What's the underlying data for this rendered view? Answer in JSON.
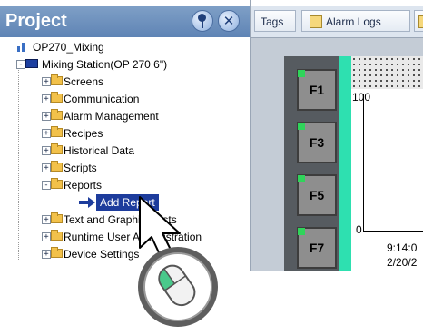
{
  "project_panel": {
    "title": "Project",
    "root": "OP270_Mixing",
    "station": "Mixing Station(OP 270 6\")",
    "items": [
      {
        "label": "Screens",
        "expander": "+"
      },
      {
        "label": "Communication",
        "expander": "+"
      },
      {
        "label": "Alarm Management",
        "expander": "+"
      },
      {
        "label": "Recipes",
        "expander": "+"
      },
      {
        "label": "Historical Data",
        "expander": "+"
      },
      {
        "label": "Scripts",
        "expander": "+"
      },
      {
        "label": "Reports",
        "expander": "-"
      },
      {
        "label": "Add Report"
      },
      {
        "label": "Text and Graphics Lists",
        "expander": "+"
      },
      {
        "label": "Runtime User Administration",
        "expander": "+"
      },
      {
        "label": "Device Settings",
        "expander": "+"
      }
    ]
  },
  "tabs": [
    {
      "label": "Tags"
    },
    {
      "label": "Alarm Logs"
    }
  ],
  "device": {
    "keys": [
      "F1",
      "F3",
      "F5",
      "F7"
    ]
  },
  "trend": {
    "y_max": "100",
    "y_min": "0",
    "time": "9:14:0",
    "date": "2/20/2"
  },
  "colors": {
    "header": "#6f91be",
    "selection": "#1d3c9c",
    "device_strip": "#2ee0b0",
    "key_indicator": "#2fd45a"
  }
}
